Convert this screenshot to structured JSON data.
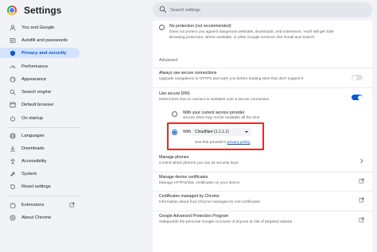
{
  "header": {
    "title": "Settings",
    "search_placeholder": "Search settings"
  },
  "sidebar": {
    "items": [
      {
        "label": "You and Google",
        "icon": "person-icon"
      },
      {
        "label": "Autofill and passwords",
        "icon": "autofill-icon"
      },
      {
        "label": "Privacy and security",
        "icon": "shield-icon",
        "active": true
      },
      {
        "label": "Performance",
        "icon": "speedometer-icon"
      },
      {
        "label": "Appearance",
        "icon": "palette-icon"
      },
      {
        "label": "Search engine",
        "icon": "search-icon"
      },
      {
        "label": "Default browser",
        "icon": "browser-icon"
      },
      {
        "label": "On startup",
        "icon": "power-icon"
      },
      {
        "label": "Languages",
        "icon": "globe-icon"
      },
      {
        "label": "Downloads",
        "icon": "download-icon"
      },
      {
        "label": "Accessibility",
        "icon": "accessibility-icon"
      },
      {
        "label": "System",
        "icon": "wrench-icon"
      },
      {
        "label": "Reset settings",
        "icon": "reset-icon"
      },
      {
        "label": "Extensions",
        "icon": "puzzle-icon"
      },
      {
        "label": "About Chrome",
        "icon": "chrome-icon"
      }
    ]
  },
  "main": {
    "no_protection": {
      "title": "No protection (not recommended)",
      "desc_line1": "Does not protect you against dangerous websites, downloads, and extensions. You'll still get Safe",
      "desc_line2": "Browsing protection, where available, in other Google services, like Gmail and Search."
    },
    "advanced_label": "Advanced",
    "https": {
      "title": "Always use secure connections",
      "desc": "Upgrade navigations to HTTPS and warn you before loading sites that don't support it",
      "enabled": false
    },
    "secure_dns": {
      "title": "Use secure DNS",
      "desc": "Determines how to connect to websites over a secure connection",
      "enabled": true,
      "option_current": {
        "title": "With your current service provider",
        "desc": "Secure DNS may not be available all the time"
      },
      "option_with": {
        "label": "With",
        "selected": "Cloudflare (1.1.1.1)",
        "policy_prefix": "See this provider's",
        "policy_link": "privacy policy"
      }
    },
    "manage_phones": {
      "title": "Manage phones",
      "desc": "Control which phones you use as security keys"
    },
    "manage_certs": {
      "title": "Manage device certificates",
      "desc": "Manage HTTPS/SSL certificates on your device"
    },
    "chrome_certs": {
      "title": "Certificates managed by Chrome",
      "desc": "Information about how Chrome manages its root certificates"
    },
    "advanced_protection": {
      "title": "Google Advanced Protection Program",
      "desc": "Safeguards the personal Google Accounts of anyone at risk of targeted attacks"
    }
  },
  "colors": {
    "accent": "#0b57d0",
    "active_nav_bg": "#d3e3fd",
    "highlight_border": "#d93025"
  }
}
